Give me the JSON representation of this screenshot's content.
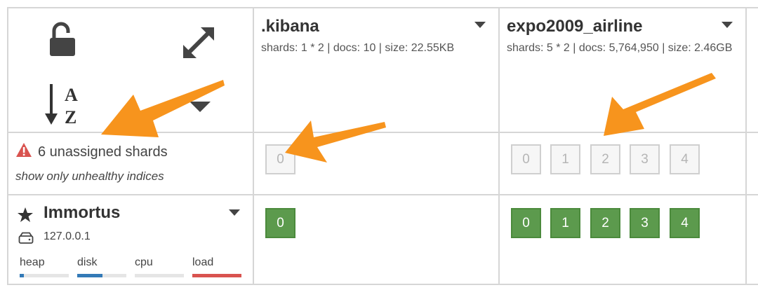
{
  "indices": [
    {
      "name": ".kibana",
      "meta": "shards: 1 * 2 | docs: 10 | size: 22.55KB",
      "unassigned": [
        "0"
      ],
      "assigned": [
        "0"
      ]
    },
    {
      "name": "expo2009_airline",
      "meta": "shards: 5 * 2 | docs: 5,764,950 | size: 2.46GB",
      "unassigned": [
        "0",
        "1",
        "2",
        "3",
        "4"
      ],
      "assigned": [
        "0",
        "1",
        "2",
        "3",
        "4"
      ]
    }
  ],
  "warning": {
    "text": "6 unassigned shards",
    "filter_label": "show only unhealthy indices"
  },
  "node": {
    "name": "Immortus",
    "ip": "127.0.0.1",
    "metrics": [
      {
        "label": "heap",
        "fill": 0.08,
        "color": "#337ab7"
      },
      {
        "label": "disk",
        "fill": 0.52,
        "color": "#337ab7"
      },
      {
        "label": "cpu",
        "fill": 0.0,
        "color": "#337ab7"
      },
      {
        "label": "load",
        "fill": 1.0,
        "color": "#d9534f"
      }
    ]
  },
  "colors": {
    "assigned": "#5c9a4d",
    "annotation_arrow": "#f7941d",
    "warning": "#d9534f"
  }
}
